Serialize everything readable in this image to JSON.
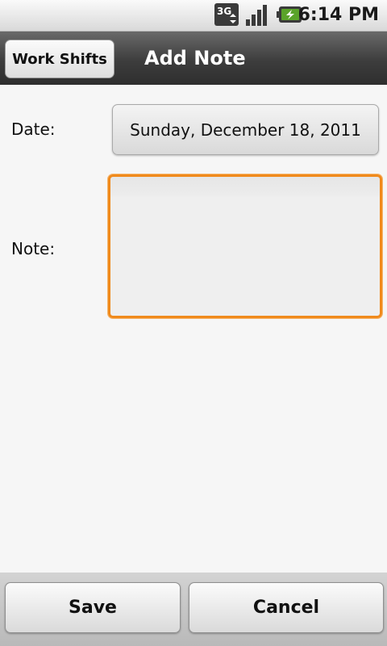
{
  "status_bar": {
    "network_icon": "3g-icon",
    "signal_icon": "signal-icon",
    "battery_icon": "battery-charging-icon",
    "time": "6:14 PM"
  },
  "title_bar": {
    "back_button_label": "Work Shifts",
    "title": "Add Note"
  },
  "form": {
    "date_label": "Date:",
    "date_value": "Sunday, December 18, 2011",
    "note_label": "Note:",
    "note_value": "",
    "focus_color": "#f08a1c"
  },
  "actions": {
    "save_label": "Save",
    "cancel_label": "Cancel"
  }
}
